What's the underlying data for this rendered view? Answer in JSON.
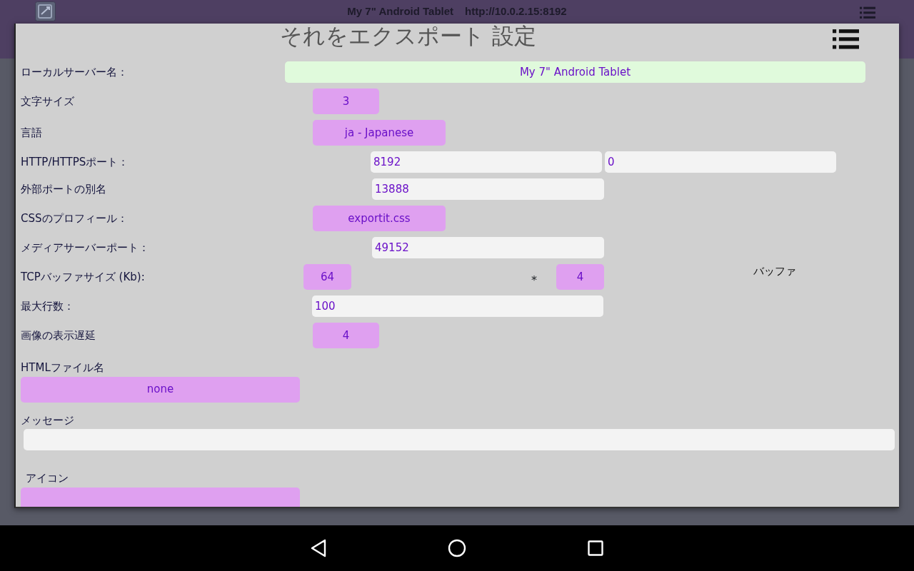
{
  "top_bar": {
    "device": "My 7\" Android Tablet",
    "address": "http://10.0.2.15:8192"
  },
  "dialog": {
    "title": "それをエクスポート 設定",
    "rows": [
      {
        "kind": "name",
        "label": "ローカルサーバー名：",
        "values": [
          "My 7\" Android Tablet"
        ]
      },
      {
        "kind": "small-select",
        "label": "文字サイズ",
        "values": [
          "3"
        ]
      },
      {
        "kind": "select",
        "label": "言語",
        "values": [
          "ja - Japanese"
        ]
      },
      {
        "kind": "ports",
        "label": "HTTP/HTTPSポート：",
        "values": [
          "8192",
          "0"
        ]
      },
      {
        "kind": "field",
        "label": "外部ポートの別名",
        "values": [
          "13888"
        ]
      },
      {
        "kind": "select",
        "label": "CSSのプロフィール：",
        "values": [
          "exportit.css"
        ]
      },
      {
        "kind": "field",
        "label": "メディアサーバーポート：",
        "values": [
          "49152"
        ]
      },
      {
        "kind": "tcp",
        "label": "TCPバッファサイズ (Kb):",
        "values": [
          "64",
          "4"
        ],
        "operator": "*",
        "note": "バッファ"
      },
      {
        "kind": "wide-field",
        "label": "最大行数：",
        "values": [
          "100"
        ]
      },
      {
        "kind": "small-select",
        "label": "画像の表示遅延",
        "values": [
          "4"
        ]
      },
      {
        "kind": "stacked-select",
        "label": "HTMLファイル名",
        "values": [
          "none"
        ]
      },
      {
        "kind": "message",
        "label": "メッセージ",
        "values": []
      },
      {
        "kind": "icon-select",
        "label": "アイコン",
        "values": []
      }
    ]
  }
}
